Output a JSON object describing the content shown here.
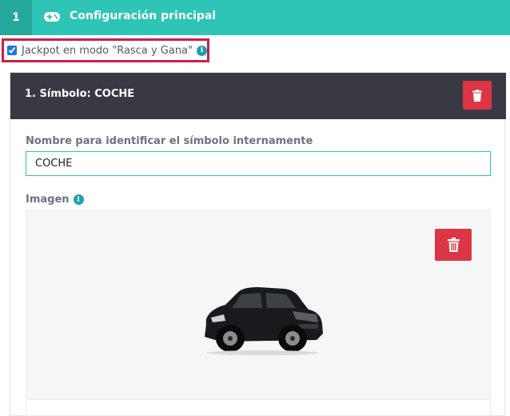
{
  "header": {
    "step_number": "1",
    "icon": "gamepad-icon",
    "title": "Configuración principal",
    "color": "#2ec4b6"
  },
  "jackpot": {
    "checked": true,
    "label": "Jackpot en modo \"Rasca y Gana\"",
    "info_icon": "info-icon",
    "highlight_color": "#cc1f4a"
  },
  "symbol": {
    "title": "1. Símbolo: COCHE",
    "delete_icon": "trash-icon",
    "name_label": "Nombre para identificar el símbolo internamente",
    "name_value": "COCHE",
    "image_label": "Imagen",
    "image_info_icon": "info-icon",
    "image_delete_icon": "trash-icon",
    "image_alt": "car-image",
    "header_color": "#393944",
    "delete_color": "#dc3545"
  }
}
